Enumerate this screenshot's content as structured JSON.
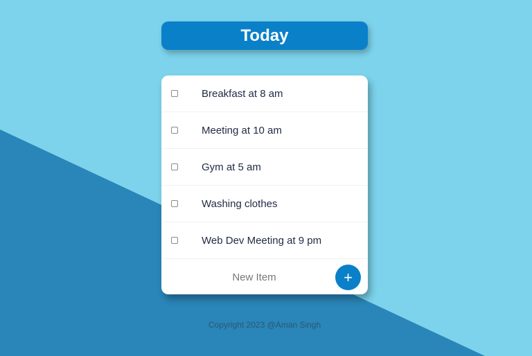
{
  "header": {
    "title": "Today"
  },
  "todo": {
    "items": [
      {
        "label": "Breakfast at 8 am",
        "checked": false
      },
      {
        "label": "Meeting at 10 am",
        "checked": false
      },
      {
        "label": "Gym at 5 am",
        "checked": false
      },
      {
        "label": "Washing clothes",
        "checked": false
      },
      {
        "label": "Web Dev Meeting at 9 pm",
        "checked": false
      }
    ],
    "new_item": {
      "placeholder": "New Item",
      "value": ""
    },
    "add_button": {
      "label": "+",
      "icon": "plus-icon"
    }
  },
  "footer": {
    "text": "Copyright 2023 @Aman Singh"
  },
  "colors": {
    "background": "#7cd3eb",
    "diagonal": "#2a85b8",
    "accent": "#0a80c9",
    "card": "#ffffff",
    "item_text": "#222b45",
    "footer_text": "#2a5874"
  }
}
